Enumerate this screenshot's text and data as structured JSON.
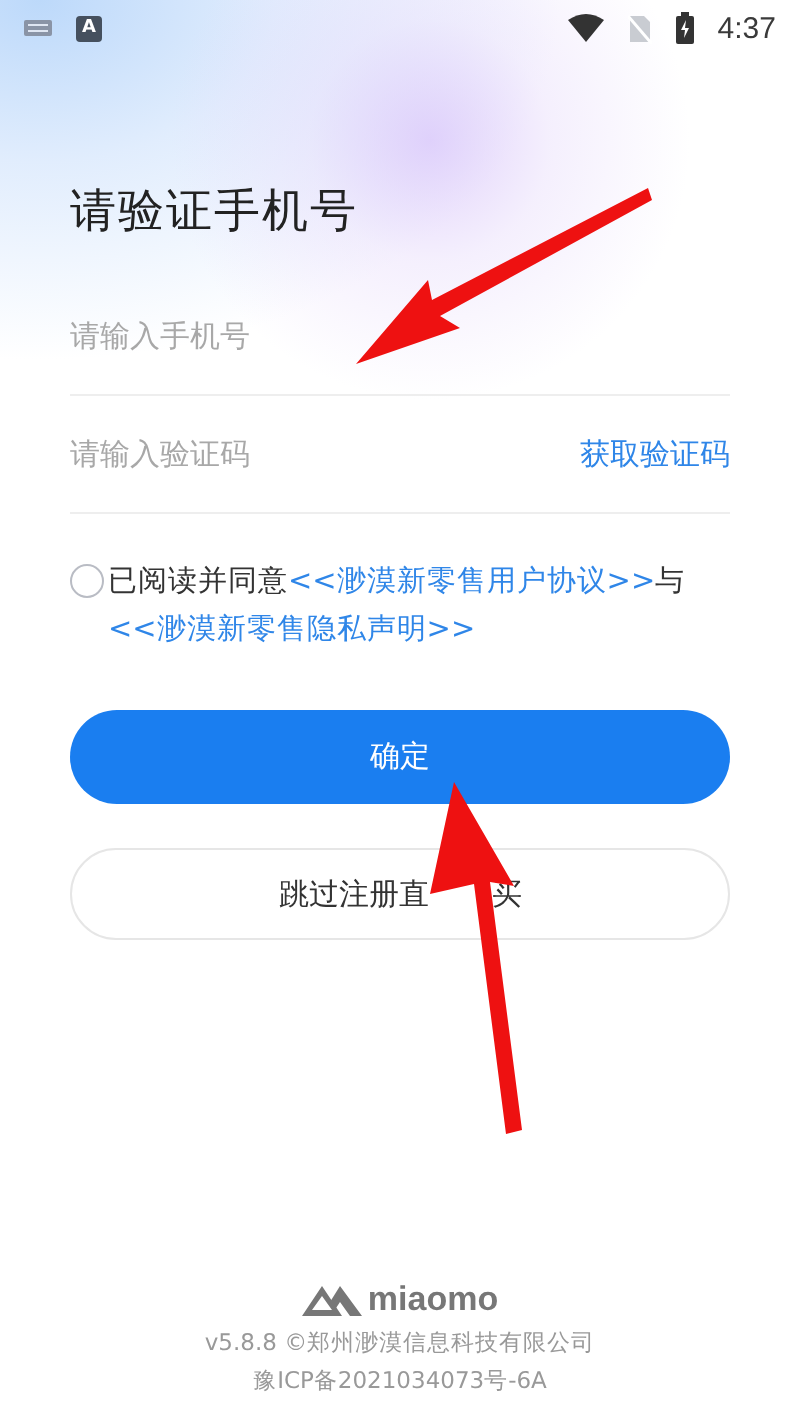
{
  "status_bar": {
    "time": "4:37",
    "input_badge": "A"
  },
  "title": "请验证手机号",
  "phone_field": {
    "placeholder": "请输入手机号"
  },
  "code_field": {
    "placeholder": "请输入验证码",
    "action": "获取验证码"
  },
  "agreement": {
    "checked": false,
    "segments": [
      {
        "kind": "text",
        "text": "已阅读并同意"
      },
      {
        "kind": "link",
        "text": "<<渺漠新零售用户协议>>"
      },
      {
        "kind": "text",
        "text": "与"
      },
      {
        "kind": "link",
        "text": "<<渺漠新零售隐私声明>>"
      }
    ]
  },
  "confirm_button": "确定",
  "skip_button": {
    "text_before_arrow": "跳过注册直",
    "text_after_arrow": "买"
  },
  "footer": {
    "brand": "miaomo",
    "copyright": "v5.8.8 ©郑州渺漠信息科技有限公司",
    "icp": "豫ICP备2021034073号-6A"
  }
}
